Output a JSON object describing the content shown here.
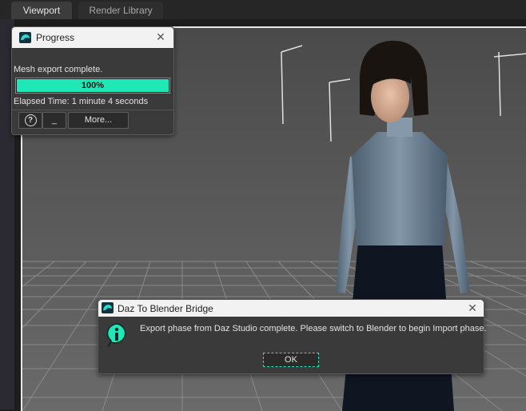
{
  "tabs": [
    {
      "label": "Viewport",
      "active": true
    },
    {
      "label": "Render Library",
      "active": false
    }
  ],
  "progress_dialog": {
    "title": "Progress",
    "status": "Mesh export complete.",
    "progress_value": 1.0,
    "progress_label": "100%",
    "elapsed": "Elapsed Time: 1 minute 4 seconds",
    "help_icon": "help-icon",
    "minimize_label": "_",
    "more_label": "More...",
    "accent_color": "#1fe8b8"
  },
  "bridge_dialog": {
    "title": "Daz To Blender Bridge",
    "message": "Export phase from Daz Studio complete. Please switch to Blender to begin Import phase.",
    "ok_label": "OK",
    "icon": "info-icon"
  },
  "close_glyph": "✕"
}
